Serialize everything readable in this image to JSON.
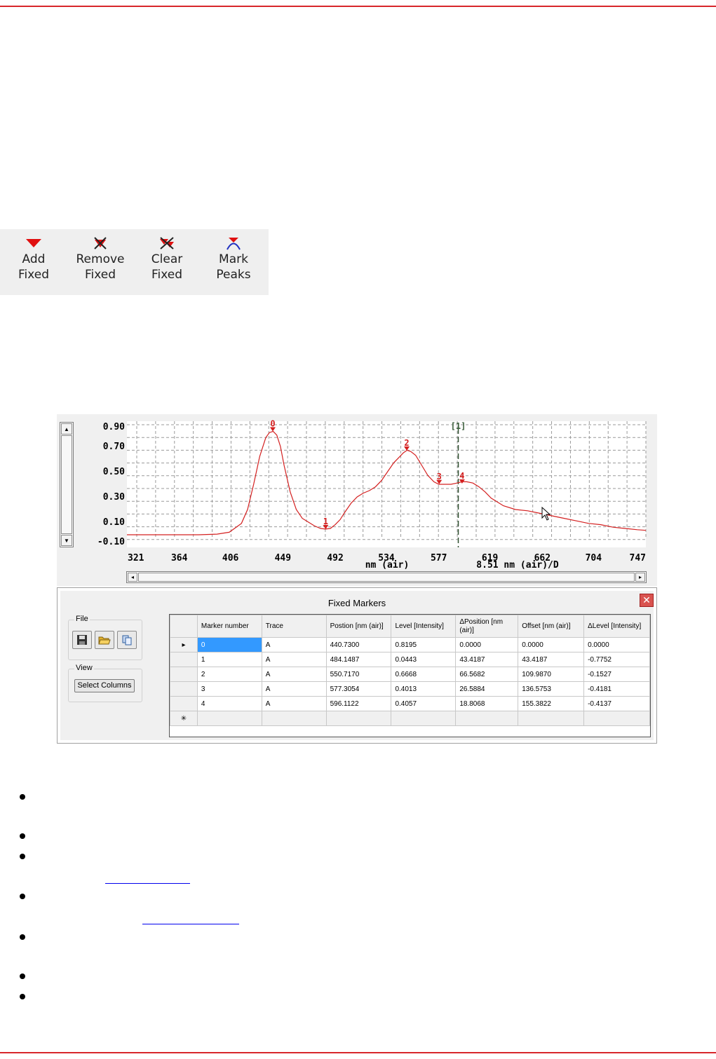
{
  "toolbar": {
    "buttons": [
      {
        "line1": "Add",
        "line2": "Fixed",
        "icon": "add-fixed-marker-icon"
      },
      {
        "line1": "Remove",
        "line2": "Fixed",
        "icon": "remove-fixed-marker-icon"
      },
      {
        "line1": "Clear",
        "line2": "Fixed",
        "icon": "clear-fixed-markers-icon"
      },
      {
        "line1": "Mark",
        "line2": "Peaks",
        "icon": "mark-peaks-icon"
      }
    ]
  },
  "chart_data": {
    "type": "line",
    "xlabel": "nm (air)",
    "scale_label": "8.51 nm (air)/D",
    "x_ticks": [
      "321",
      "364",
      "406",
      "449",
      "492",
      "534",
      "577",
      "619",
      "662",
      "704",
      "747"
    ],
    "y_ticks": [
      "0.90",
      "0.70",
      "0.50",
      "0.30",
      "0.10",
      "-0.10"
    ],
    "xlim": [
      321,
      747
    ],
    "ylim": [
      -0.1,
      0.9
    ],
    "grid": true,
    "line_color": "#d42020",
    "series": [
      {
        "x": [
          321,
          340,
          360,
          380,
          395,
          405,
          415,
          420,
          425,
          430,
          435,
          438,
          441,
          444,
          447,
          450,
          455,
          460,
          465,
          470,
          475,
          480,
          484,
          488,
          492,
          496,
          500,
          505,
          510,
          515,
          520,
          525,
          530,
          535,
          540,
          545,
          548,
          551,
          554,
          558,
          563,
          568,
          573,
          577,
          582,
          587,
          592,
          596,
          600,
          605,
          610,
          615,
          620,
          630,
          640,
          650,
          660,
          670,
          680,
          690,
          700,
          710,
          720,
          730,
          740,
          747
        ],
        "y": [
          0.0,
          0.0,
          0.0,
          0.0,
          0.005,
          0.02,
          0.09,
          0.2,
          0.4,
          0.62,
          0.77,
          0.81,
          0.82,
          0.79,
          0.7,
          0.55,
          0.34,
          0.2,
          0.13,
          0.1,
          0.07,
          0.05,
          0.045,
          0.05,
          0.08,
          0.12,
          0.18,
          0.25,
          0.3,
          0.33,
          0.35,
          0.38,
          0.43,
          0.5,
          0.57,
          0.62,
          0.65,
          0.67,
          0.66,
          0.63,
          0.55,
          0.47,
          0.42,
          0.4,
          0.4,
          0.4,
          0.41,
          0.42,
          0.42,
          0.41,
          0.38,
          0.34,
          0.29,
          0.23,
          0.2,
          0.19,
          0.17,
          0.15,
          0.13,
          0.11,
          0.09,
          0.08,
          0.06,
          0.05,
          0.04,
          0.035
        ]
      }
    ],
    "markers": [
      {
        "label": "0",
        "x": 440.73,
        "y": 0.8195
      },
      {
        "label": "1",
        "x": 484.1487,
        "y": 0.0443
      },
      {
        "label": "2",
        "x": 550.717,
        "y": 0.6668
      },
      {
        "label": "3",
        "x": 577.3054,
        "y": 0.4013
      },
      {
        "label": "4",
        "x": 596.1122,
        "y": 0.4057
      }
    ],
    "cursor": {
      "label": "[1]",
      "x": 593
    }
  },
  "fixed_markers": {
    "title": "Fixed Markers",
    "close_label": "✕",
    "file_group": "File",
    "view_group": "View",
    "select_columns": "Select Columns",
    "headers": [
      "Marker number",
      "Trace",
      "Postion [nm (air)]",
      "Level [Intensity]",
      "ΔPosition [nm (air)]",
      "Offset [nm (air)]",
      "ΔLevel [Intensity]"
    ],
    "rows": [
      [
        "0",
        "A",
        "440.7300",
        "0.8195",
        "0.0000",
        "0.0000",
        "0.0000"
      ],
      [
        "1",
        "A",
        "484.1487",
        "0.0443",
        "43.4187",
        "43.4187",
        "-0.7752"
      ],
      [
        "2",
        "A",
        "550.7170",
        "0.6668",
        "66.5682",
        "109.9870",
        "-0.1527"
      ],
      [
        "3",
        "A",
        "577.3054",
        "0.4013",
        "26.5884",
        "136.5753",
        "-0.4181"
      ],
      [
        "4",
        "A",
        "596.1122",
        "0.4057",
        "18.8068",
        "155.3822",
        "-0.4137"
      ]
    ],
    "current_row_symbol": "▸",
    "new_row_symbol": "✳"
  }
}
